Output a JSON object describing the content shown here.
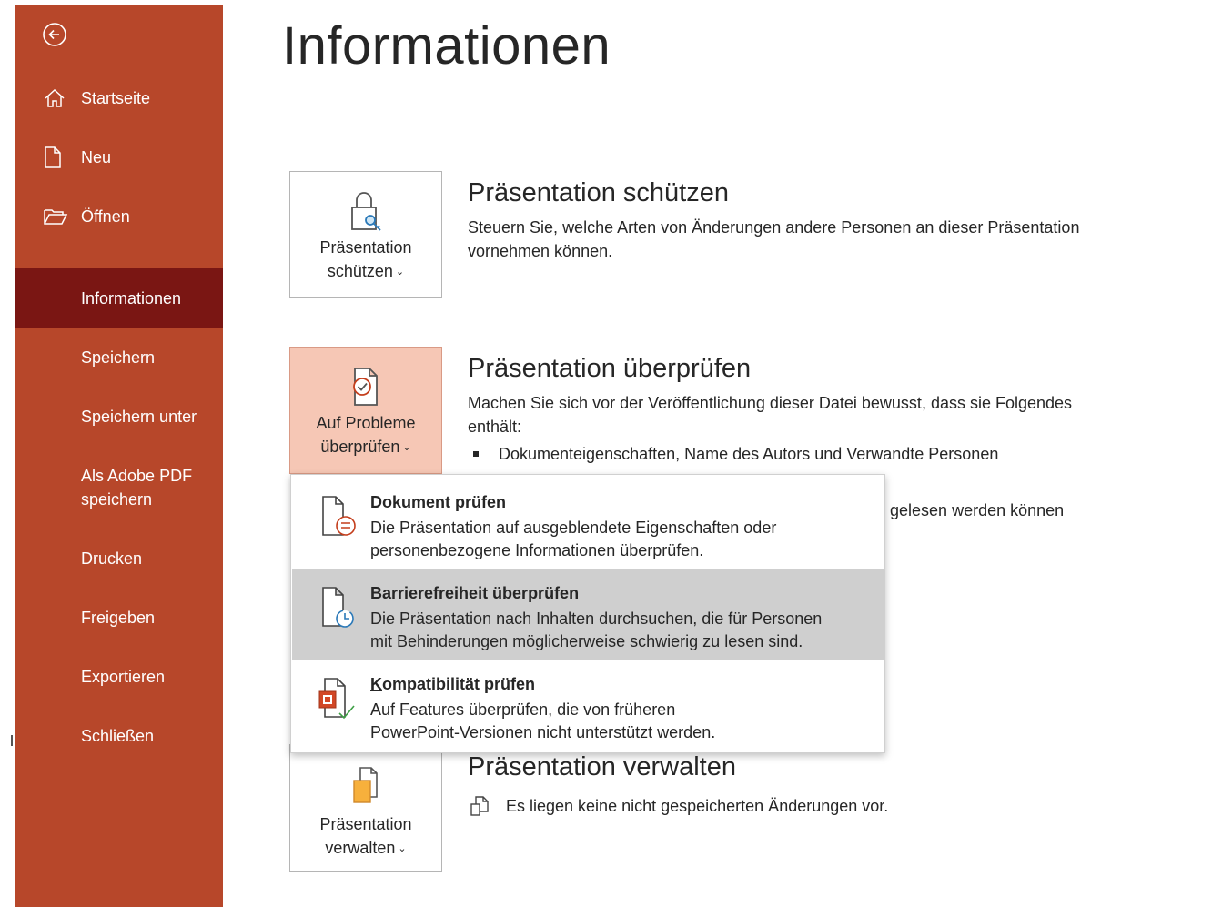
{
  "sidebar": {
    "top_items": [
      {
        "label": "Startseite",
        "icon": "home-icon"
      },
      {
        "label": "Neu",
        "icon": "new-document-icon"
      },
      {
        "label": "Öffnen",
        "icon": "open-folder-icon"
      }
    ],
    "items": [
      {
        "label": "Informationen",
        "active": true
      },
      {
        "label": "Speichern"
      },
      {
        "label": "Speichern unter"
      },
      {
        "label": "Als Adobe PDF speichern",
        "line1": "Als Adobe PDF",
        "line2": "speichern"
      },
      {
        "label": "Drucken"
      },
      {
        "label": "Freigeben"
      },
      {
        "label": "Exportieren"
      },
      {
        "label": "Schließen"
      }
    ]
  },
  "page": {
    "title": "Informationen"
  },
  "protect": {
    "tile_line1": "Präsentation",
    "tile_line2": "schützen",
    "title": "Präsentation schützen",
    "description": "Steuern Sie, welche Arten von Änderungen andere Personen an dieser Präsentation vornehmen können."
  },
  "inspect": {
    "tile_line1": "Auf Probleme",
    "tile_line2": "überprüfen",
    "title": "Präsentation überprüfen",
    "description": "Machen Sie sich vor der Veröffentlichung dieser Datei bewusst, dass sie Folgendes enthält:",
    "bullet1": "Dokumenteigenschaften, Name des Autors und Verwandte Personen",
    "partial_text": "ht gelesen werden können"
  },
  "dropdown": {
    "items": [
      {
        "title_u": "D",
        "title_rest": "okument prüfen",
        "title": "Dokument prüfen",
        "desc_line1": "Die Präsentation auf ausgeblendete Eigenschaften oder",
        "desc_line2": "personenbezogene Informationen überprüfen."
      },
      {
        "title_u": "B",
        "title_rest": "arrierefreiheit überprüfen",
        "title": "Barrierefreiheit überprüfen",
        "desc_line1": "Die Präsentation nach Inhalten durchsuchen, die für Personen",
        "desc_line2": "mit Behinderungen möglicherweise schwierig zu lesen sind."
      },
      {
        "title_u": "K",
        "title_rest": "ompatibilität prüfen",
        "title": "Kompatibilität prüfen",
        "desc_line1": "Auf Features überprüfen, die von früheren",
        "desc_line2": "PowerPoint-Versionen nicht unterstützt werden."
      }
    ]
  },
  "manage": {
    "tile_line1": "Präsentation",
    "tile_line2": "verwalten",
    "title": "Präsentation verwalten",
    "status": "Es liegen keine nicht gespeicherten Änderungen vor."
  },
  "colors": {
    "sidebar_bg": "#b7472a",
    "sidebar_active": "#7a1613",
    "tile_pressed": "#f6c7b5",
    "hover": "#cfcfcf"
  }
}
